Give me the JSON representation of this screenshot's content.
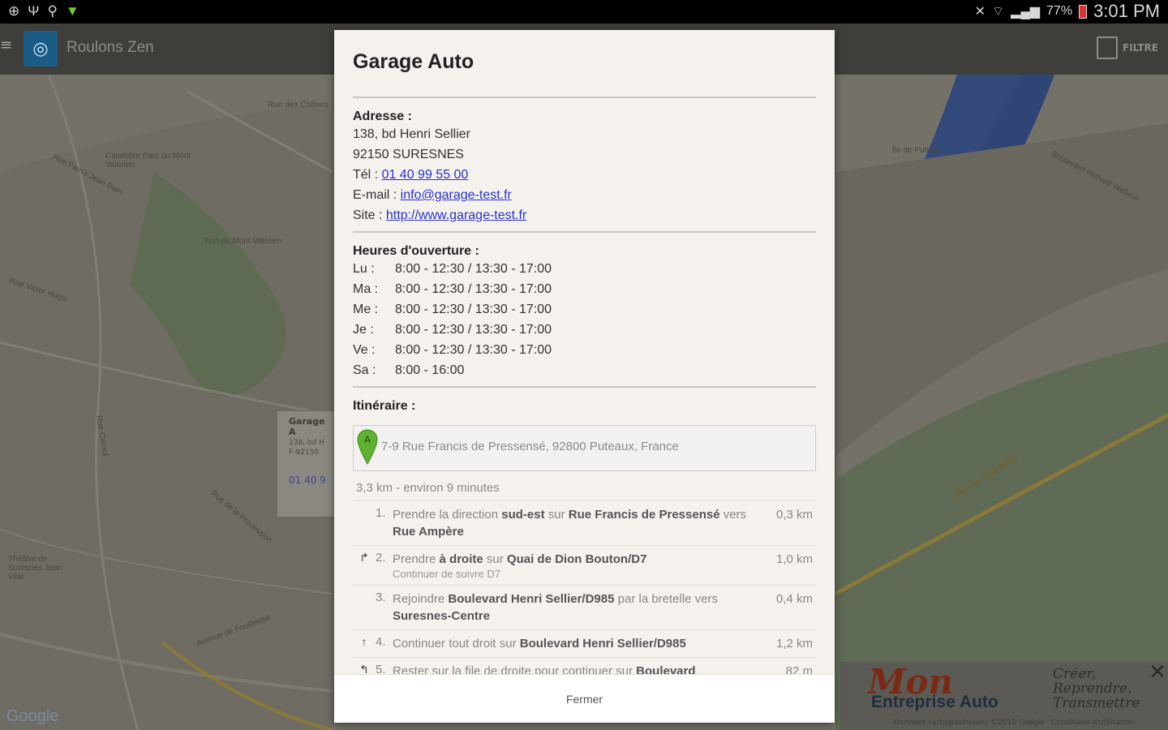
{
  "statusbar": {
    "battery": "77%",
    "time": "3:01 PM"
  },
  "app": {
    "title": "Roulons Zen",
    "filter_label": "FILTRE"
  },
  "map": {
    "labels": [
      "Rue des Chênes",
      "Cimetière Parc du Mont Valérien",
      "Rue Pierre Jean Barn",
      "Fort du Mont Valérien",
      "Rue Victor Hugo",
      "Île de Puteaux",
      "Boulevard Richard Wallace",
      "Allée de Longchamp",
      "Théâtre de Suresnes Jean Vilar",
      "Rue de la Procession",
      "Avenue de Fouilleuse",
      "Rue Carnot"
    ],
    "callout": {
      "title": "Garage A",
      "line1": "138, bd H",
      "line2": "F-92150",
      "phone": "01 40 9"
    },
    "google_logo": "Google"
  },
  "ad": {
    "brand_top": "Mon",
    "brand_bottom": "Entreprise Auto",
    "slogan": "Créer,\nReprendre,\nTransmettre",
    "close": "✕",
    "credit": "Données cartographiques ©2015 Google · Conditions d'utilisation"
  },
  "dialog": {
    "title": "Garage Auto",
    "address": {
      "heading": "Adresse :",
      "street": "138, bd Henri Sellier",
      "city": "92150 SURESNES",
      "tel_label": "Tél : ",
      "tel": "01 40 99 55 00",
      "email_label": "E-mail : ",
      "email": "info@garage-test.fr",
      "site_label": "Site : ",
      "site": "http://www.garage-test.fr"
    },
    "hours": {
      "heading": "Heures d'ouverture :",
      "rows": [
        {
          "day": "Lu :",
          "time": "8:00 - 12:30 / 13:30 - 17:00"
        },
        {
          "day": "Ma :",
          "time": "8:00 - 12:30 / 13:30 - 17:00"
        },
        {
          "day": "Me :",
          "time": "8:00 - 12:30 / 13:30 - 17:00"
        },
        {
          "day": "Je :",
          "time": "8:00 - 12:30 / 13:30 - 17:00"
        },
        {
          "day": "Ve :",
          "time": "8:00 - 12:30 / 13:30 - 17:00"
        },
        {
          "day": "Sa :",
          "time": "8:00 - 16:00"
        }
      ]
    },
    "route": {
      "heading": "Itinéraire :",
      "pin_label": "A",
      "origin": "7-9 Rue Francis de Pressensé, 92800 Puteaux, France",
      "summary": "3,3 km - environ 9 minutes",
      "steps": [
        {
          "icon": "",
          "num": "1.",
          "html_parts": [
            "Prendre la direction ",
            "sud-est",
            " sur ",
            "Rue Francis de Pressensé",
            " vers ",
            "Rue Ampère"
          ],
          "sub": "",
          "dist": "0,3 km"
        },
        {
          "icon": "↱",
          "num": "2.",
          "html_parts": [
            "Prendre ",
            "à droite",
            " sur ",
            "Quai de Dion Bouton/D7"
          ],
          "sub": "Continuer de suivre D7",
          "dist": "1,0 km"
        },
        {
          "icon": "",
          "num": "3.",
          "html_parts": [
            "Rejoindre ",
            "Boulevard Henri Sellier/D985",
            " par la bretelle vers ",
            "Suresnes-Centre"
          ],
          "sub": "",
          "dist": "0,4 km"
        },
        {
          "icon": "↑",
          "num": "4.",
          "html_parts": [
            "Continuer tout droit sur ",
            "Boulevard Henri Sellier/D985"
          ],
          "sub": "",
          "dist": "1,2 km"
        },
        {
          "icon": "↰",
          "num": "5.",
          "html_parts": [
            "Rester sur la file de droite pour continuer sur ",
            "Boulevard"
          ],
          "sub": "",
          "dist": "82 m"
        }
      ]
    },
    "close_label": "Fermer"
  },
  "colors": {
    "link": "#2933d1",
    "pin": "#5fb130",
    "app_icon": "#1b5c86"
  }
}
